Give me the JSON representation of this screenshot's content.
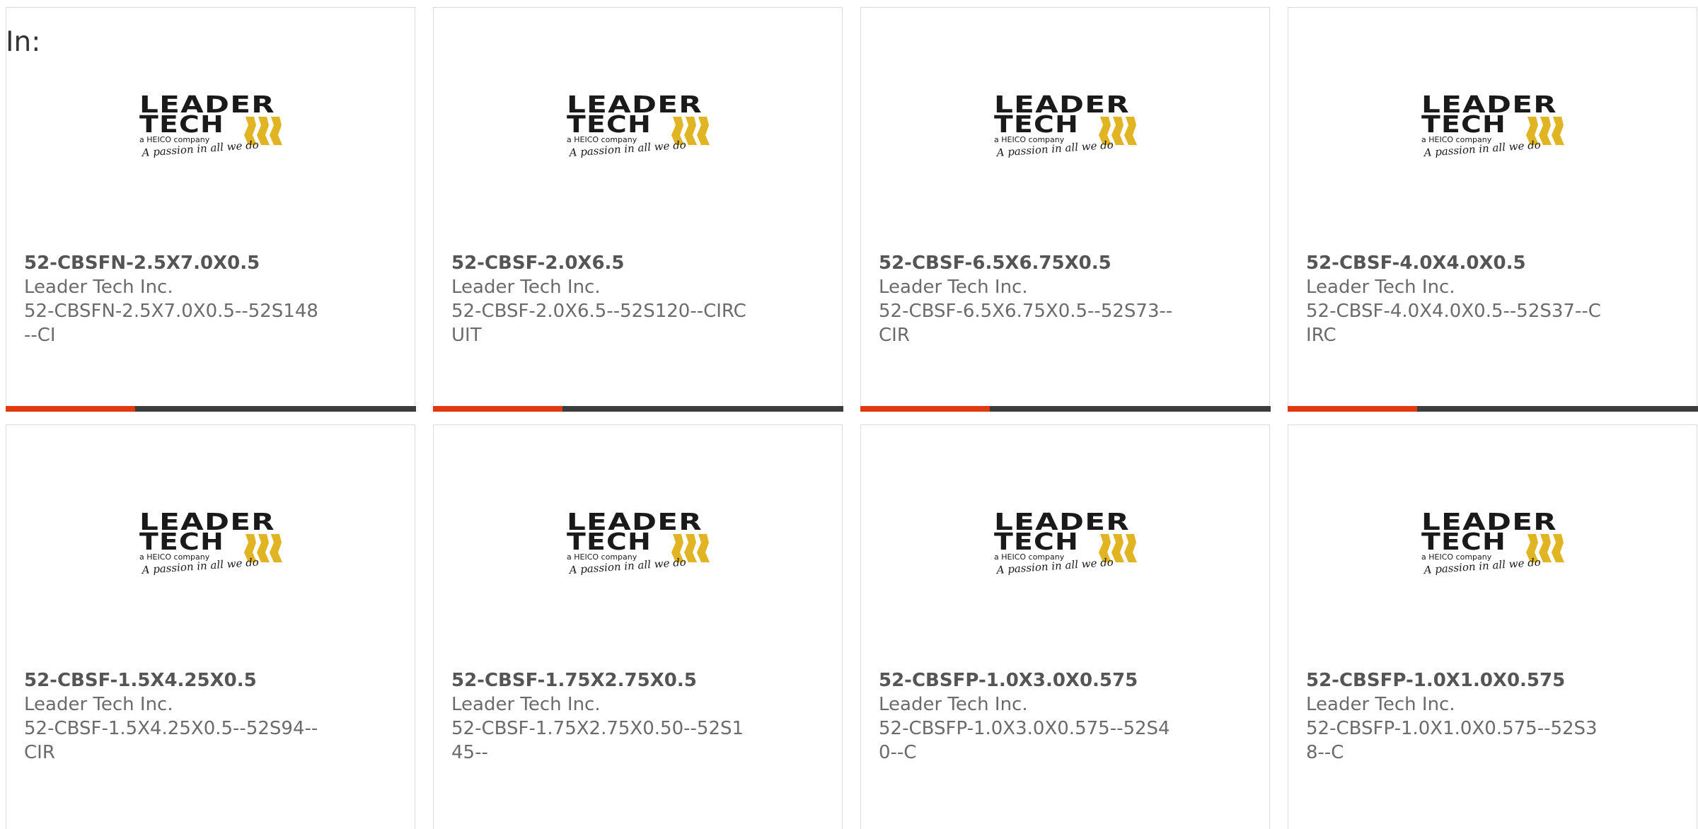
{
  "header": {
    "in_label": "In:"
  },
  "logo": {
    "line1": "LEADER",
    "line2": "TECH",
    "tagline": "a HEICO company",
    "slogan": "A passion in all we do",
    "colors": {
      "text": "#1a1a1a",
      "stripes": "#e0b422"
    }
  },
  "colors": {
    "accent": "#e2380f",
    "bar": "#3d3d3d",
    "border": "#dcdcdc"
  },
  "products": [
    {
      "title": "52-CBSFN-2.5X7.0X0.5",
      "manufacturer": "Leader Tech Inc.",
      "description": "52-CBSFN-2.5X7.0X0.5--52S148--CI"
    },
    {
      "title": "52-CBSF-2.0X6.5",
      "manufacturer": "Leader Tech Inc.",
      "description": "52-CBSF-2.0X6.5--52S120--CIRCUIT"
    },
    {
      "title": "52-CBSF-6.5X6.75X0.5",
      "manufacturer": "Leader Tech Inc.",
      "description": "52-CBSF-6.5X6.75X0.5--52S73--CIR"
    },
    {
      "title": "52-CBSF-4.0X4.0X0.5",
      "manufacturer": "Leader Tech Inc.",
      "description": "52-CBSF-4.0X4.0X0.5--52S37--CIRC"
    },
    {
      "title": "52-CBSF-1.5X4.25X0.5",
      "manufacturer": "Leader Tech Inc.",
      "description": "52-CBSF-1.5X4.25X0.5--52S94--CIR"
    },
    {
      "title": "52-CBSF-1.75X2.75X0.5",
      "manufacturer": "Leader Tech Inc.",
      "description": "52-CBSF-1.75X2.75X0.50--52S145--"
    },
    {
      "title": "52-CBSFP-1.0X3.0X0.575",
      "manufacturer": "Leader Tech Inc.",
      "description": "52-CBSFP-1.0X3.0X0.575--52S40--C"
    },
    {
      "title": "52-CBSFP-1.0X1.0X0.575",
      "manufacturer": "Leader Tech Inc.",
      "description": "52-CBSFP-1.0X1.0X0.575--52S38--C"
    }
  ]
}
